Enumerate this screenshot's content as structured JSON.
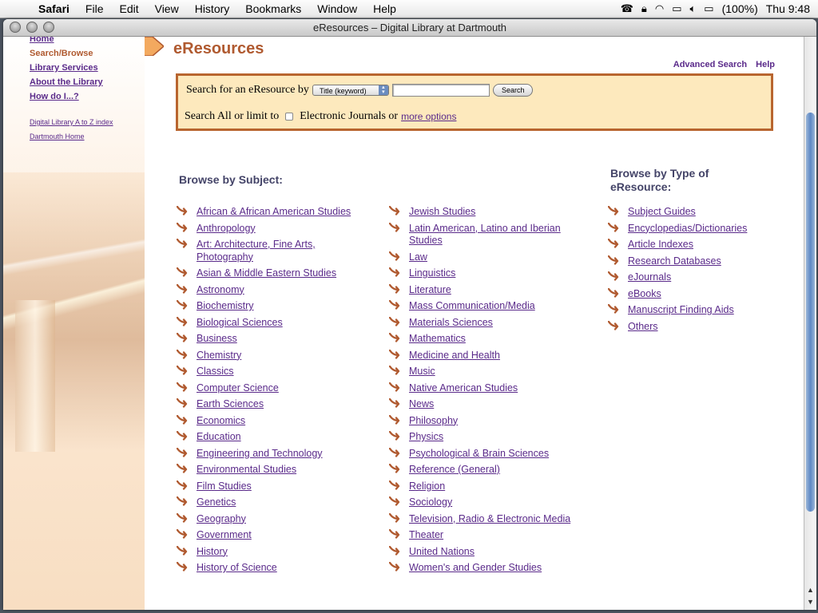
{
  "menubar": {
    "app": "Safari",
    "items": [
      "File",
      "Edit",
      "View",
      "History",
      "Bookmarks",
      "Window",
      "Help"
    ],
    "battery": "(100%)",
    "clock": "Thu 9:48"
  },
  "window": {
    "title": "eResources – Digital Library at Dartmouth"
  },
  "sidebar": {
    "links": [
      "Home",
      "Search/Browse",
      "Library Services",
      "About the Library",
      "How do I...?"
    ],
    "small_links": [
      "Digital Library A to Z index",
      "Dartmouth Home"
    ]
  },
  "page": {
    "title": "eResources",
    "advanced_search": "Advanced Search",
    "help": "Help"
  },
  "search": {
    "label": "Search for an eResource by",
    "select_value": "Title (keyword)",
    "input_value": "",
    "button": "Search",
    "limit_label": "Search All or limit to",
    "checkbox_label": "Electronic Journals or",
    "more_options": "more options"
  },
  "browse_subject": {
    "heading": "Browse by Subject:",
    "col1": [
      "African & African American Studies",
      "Anthropology",
      "Art: Architecture, Fine Arts, Photography",
      "Asian & Middle Eastern Studies",
      "Astronomy",
      "Biochemistry",
      "Biological Sciences",
      "Business",
      "Chemistry",
      "Classics",
      "Computer Science",
      "Earth Sciences",
      "Economics",
      "Education",
      "Engineering and Technology",
      "Environmental Studies",
      "Film Studies",
      "Genetics",
      "Geography",
      "Government",
      "History",
      "History of Science"
    ],
    "col2": [
      "Jewish Studies",
      "Latin American, Latino and Iberian Studies",
      "Law",
      "Linguistics",
      "Literature",
      "Mass Communication/Media",
      "Materials Sciences",
      "Mathematics",
      "Medicine and Health",
      "Music",
      "Native American Studies",
      "News",
      "Philosophy",
      "Physics",
      "Psychological & Brain Sciences",
      "Reference (General)",
      "Religion",
      "Sociology",
      "Television, Radio & Electronic Media",
      "Theater",
      "United Nations",
      "Women's and Gender Studies"
    ]
  },
  "browse_type": {
    "heading": "Browse by Type of eResource:",
    "items": [
      "Subject Guides",
      "Encyclopedias/Dictionaries",
      "Article Indexes",
      "Research Databases",
      "eJournals",
      "eBooks",
      "Manuscript Finding Aids",
      "Others"
    ]
  },
  "colors": {
    "accent": "#b05a30",
    "link": "#5a2a8a",
    "search_bg": "#fde9bd"
  }
}
